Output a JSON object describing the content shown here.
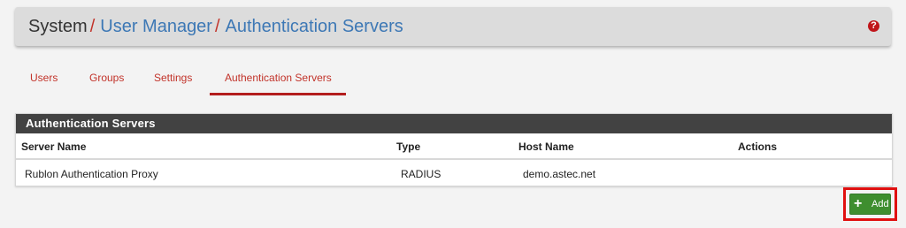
{
  "breadcrumb": {
    "root": "System",
    "separator": "/",
    "item1": "User Manager",
    "item2": "Authentication Servers"
  },
  "header": {
    "help_icon": "question-circle-icon",
    "help_glyph": "?"
  },
  "tabs": [
    {
      "label": "Users"
    },
    {
      "label": "Groups"
    },
    {
      "label": "Settings"
    },
    {
      "label": "Authentication Servers",
      "active": true
    }
  ],
  "panel": {
    "title": "Authentication Servers",
    "columns": [
      "Server Name",
      "Type",
      "Host Name",
      "Actions"
    ],
    "rows": [
      {
        "server_name": "Rublon Authentication Proxy",
        "type": "RADIUS",
        "host_name": "demo.astec.net",
        "actions": ""
      }
    ]
  },
  "add_button": {
    "label": "Add",
    "icon": "plus-icon",
    "glyph": "+"
  },
  "colors": {
    "accent_red": "#c2332a",
    "link_blue": "#3d78b5",
    "panel_heading": "#424242",
    "button_green": "#3e8e2f",
    "highlight": "#e01010"
  }
}
